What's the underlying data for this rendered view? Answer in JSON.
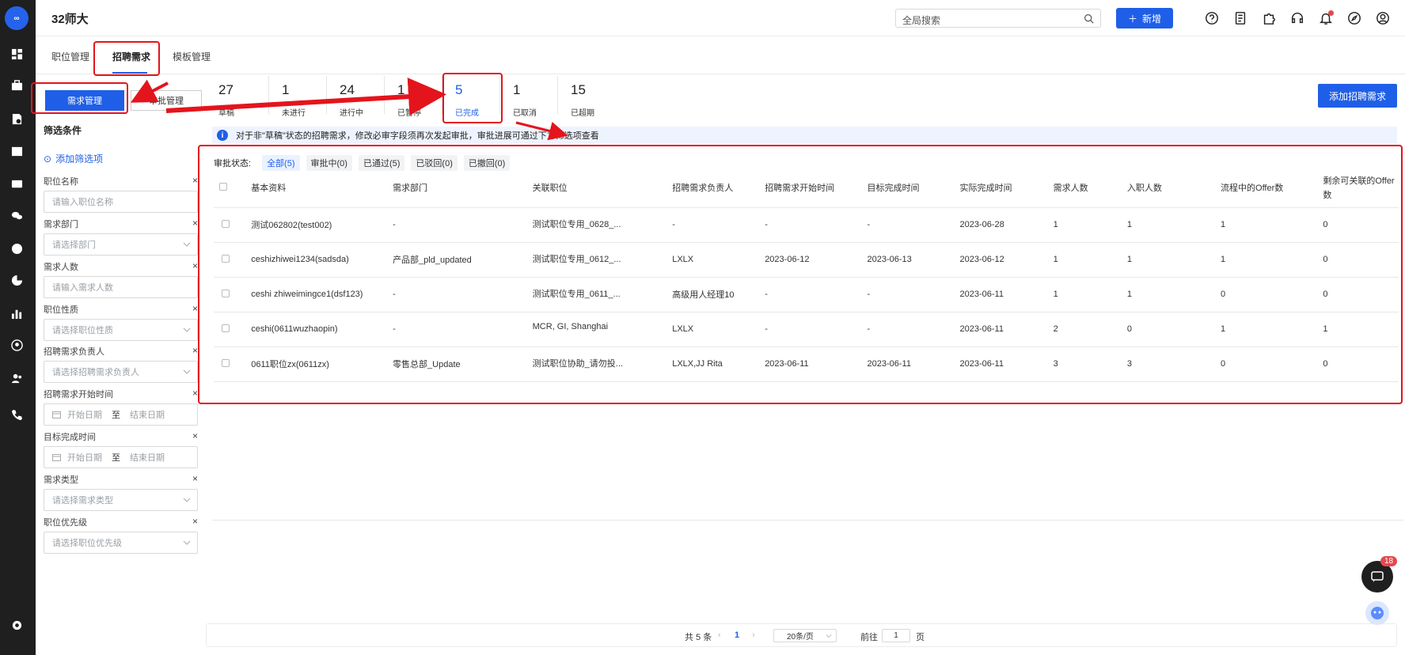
{
  "app": {
    "title": "32师大",
    "logo_text": "∞"
  },
  "topbar": {
    "search_placeholder": "全局搜索",
    "new_label": "新增"
  },
  "tabs": [
    {
      "label": "职位管理"
    },
    {
      "label": "招聘需求"
    },
    {
      "label": "模板管理"
    }
  ],
  "left": {
    "btn_demand": "需求管理",
    "btn_approval": "审批管理",
    "filter_title": "筛选条件",
    "add_filter": "添加筛选项",
    "fields": [
      {
        "label": "职位名称",
        "placeholder": "请输入职位名称"
      },
      {
        "label": "需求部门",
        "placeholder": "请选择部门"
      },
      {
        "label": "需求人数",
        "placeholder": "请输入需求人数"
      },
      {
        "label": "职位性质",
        "placeholder": "请选择职位性质"
      },
      {
        "label": "招聘需求负责人",
        "placeholder": "请选择招聘需求负责人"
      },
      {
        "label": "招聘需求开始时间",
        "start": "开始日期",
        "sep": "至",
        "end": "结束日期"
      },
      {
        "label": "目标完成时间",
        "start": "开始日期",
        "sep": "至",
        "end": "结束日期"
      },
      {
        "label": "需求类型",
        "placeholder": "请选择需求类型"
      },
      {
        "label": "职位优先级",
        "placeholder": "请选择职位优先级"
      }
    ]
  },
  "stats": [
    {
      "num": "27",
      "label": "草稿"
    },
    {
      "num": "1",
      "label": "未进行"
    },
    {
      "num": "24",
      "label": "进行中"
    },
    {
      "num": "1",
      "label": "已暂停"
    },
    {
      "num": "5",
      "label": "已完成"
    },
    {
      "num": "1",
      "label": "已取消"
    },
    {
      "num": "15",
      "label": "已超期"
    }
  ],
  "add_request": "添加招聘需求",
  "notice": "对于非\"草稿\"状态的招聘需求，修改必审字段须再次发起审批，审批进展可通过下方筛选项查看",
  "approval": {
    "label": "审批状态:",
    "chips": [
      "全部(5)",
      "审批中(0)",
      "已通过(5)",
      "已驳回(0)",
      "已撤回(0)"
    ]
  },
  "table": {
    "headers": [
      "基本资料",
      "需求部门",
      "关联职位",
      "招聘需求负责人",
      "招聘需求开始时间",
      "目标完成时间",
      "实际完成时间",
      "需求人数",
      "入职人数",
      "流程中的Offer数",
      "剩余可关联的Offer数"
    ],
    "rows": [
      [
        "测试062802(test002)",
        "-",
        "测试职位专用_0628_...",
        "-",
        "-",
        "-",
        "2023-06-28",
        "1",
        "1",
        "1",
        "0"
      ],
      [
        "ceshizhiwei1234(sadsda)",
        "产品部_pld_updated",
        "测试职位专用_0612_...",
        "LXLX",
        "2023-06-12",
        "2023-06-13",
        "2023-06-12",
        "1",
        "1",
        "1",
        "0"
      ],
      [
        "ceshi zhiweimingce1(dsf123)",
        "-",
        "测试职位专用_0611_...",
        "高级用人经理10",
        "-",
        "-",
        "2023-06-11",
        "1",
        "1",
        "0",
        "0"
      ],
      [
        "ceshi(0611wuzhaopin)",
        "-",
        "MCR, GI, Shanghai",
        "LXLX",
        "-",
        "-",
        "2023-06-11",
        "2",
        "0",
        "1",
        "1"
      ],
      [
        "0611职位zx(0611zx)",
        "零售总部_Update",
        "测试职位协助_请勿投...",
        "LXLX,JJ Rita",
        "2023-06-11",
        "2023-06-11",
        "2023-06-11",
        "3",
        "3",
        "0",
        "0"
      ]
    ]
  },
  "pager": {
    "total": "共 5 条",
    "page": "1",
    "size": "20条/页",
    "goto": "前往",
    "goto_val": "1",
    "unit": "页"
  },
  "chat_badge": "18",
  "colors": {
    "primary": "#1f5fe8",
    "rail": "#1f1f1f",
    "annotation": "#e4141c"
  }
}
